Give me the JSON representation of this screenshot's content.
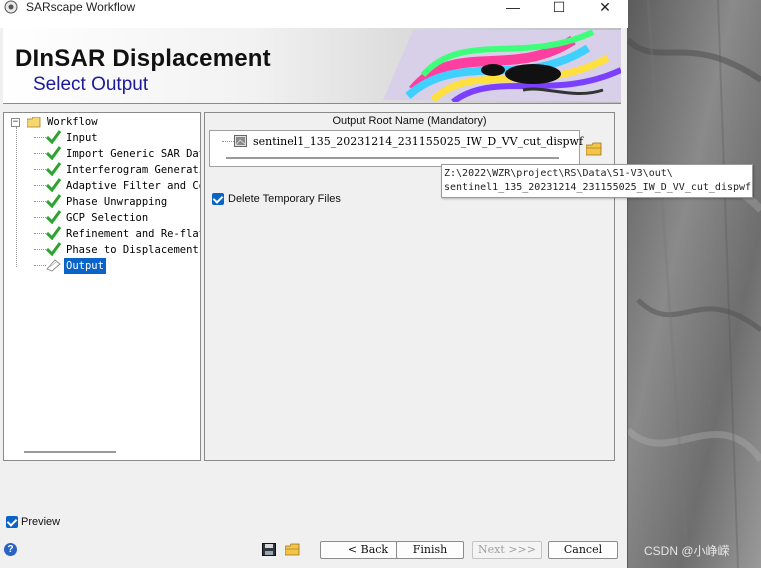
{
  "window": {
    "title": "SARscape Workflow",
    "controls": {
      "minimize": "—",
      "maximize": "☐",
      "close": "✕"
    }
  },
  "header": {
    "title": "DInSAR Displacement",
    "subtitle": "Select Output"
  },
  "tree": {
    "root": "Workflow",
    "items": [
      {
        "label": "Input",
        "done": true
      },
      {
        "label": "Import Generic SAR Data",
        "done": true
      },
      {
        "label": "Interferogram Generation",
        "done": true
      },
      {
        "label": "Adaptive Filter and Coherence",
        "done": true
      },
      {
        "label": "Phase Unwrapping",
        "done": true
      },
      {
        "label": "GCP Selection",
        "done": true
      },
      {
        "label": "Refinement and Re-flattening",
        "done": true
      },
      {
        "label": "Phase to Displacement Conversion",
        "done": true
      },
      {
        "label": "Output",
        "done": false,
        "selected": true
      }
    ]
  },
  "output": {
    "group_label": "Output Root Name (Mandatory)",
    "file_name": "sentinel1_135_20231214_231155025_IW_D_VV_cut_dispwf",
    "tooltip_line1": "Z:\\2022\\WZR\\project\\RS\\Data\\S1-V3\\out\\",
    "tooltip_line2": "sentinel1_135_20231214_231155025_IW_D_VV_cut_dispwf",
    "delete_temp_label": "Delete Temporary Files",
    "delete_temp_checked": true
  },
  "footer": {
    "preview_label": "Preview",
    "preview_checked": true,
    "help_glyph": "?",
    "back_label": "< Back",
    "finish_label": "Finish",
    "next_label": "Next >>>",
    "cancel_label": "Cancel",
    "next_enabled": false
  },
  "watermark": "CSDN @小峥嵘",
  "colors": {
    "accent": "#0a64c8",
    "check_green": "#2aa52a",
    "subtitle_blue": "#1a1a9a"
  }
}
